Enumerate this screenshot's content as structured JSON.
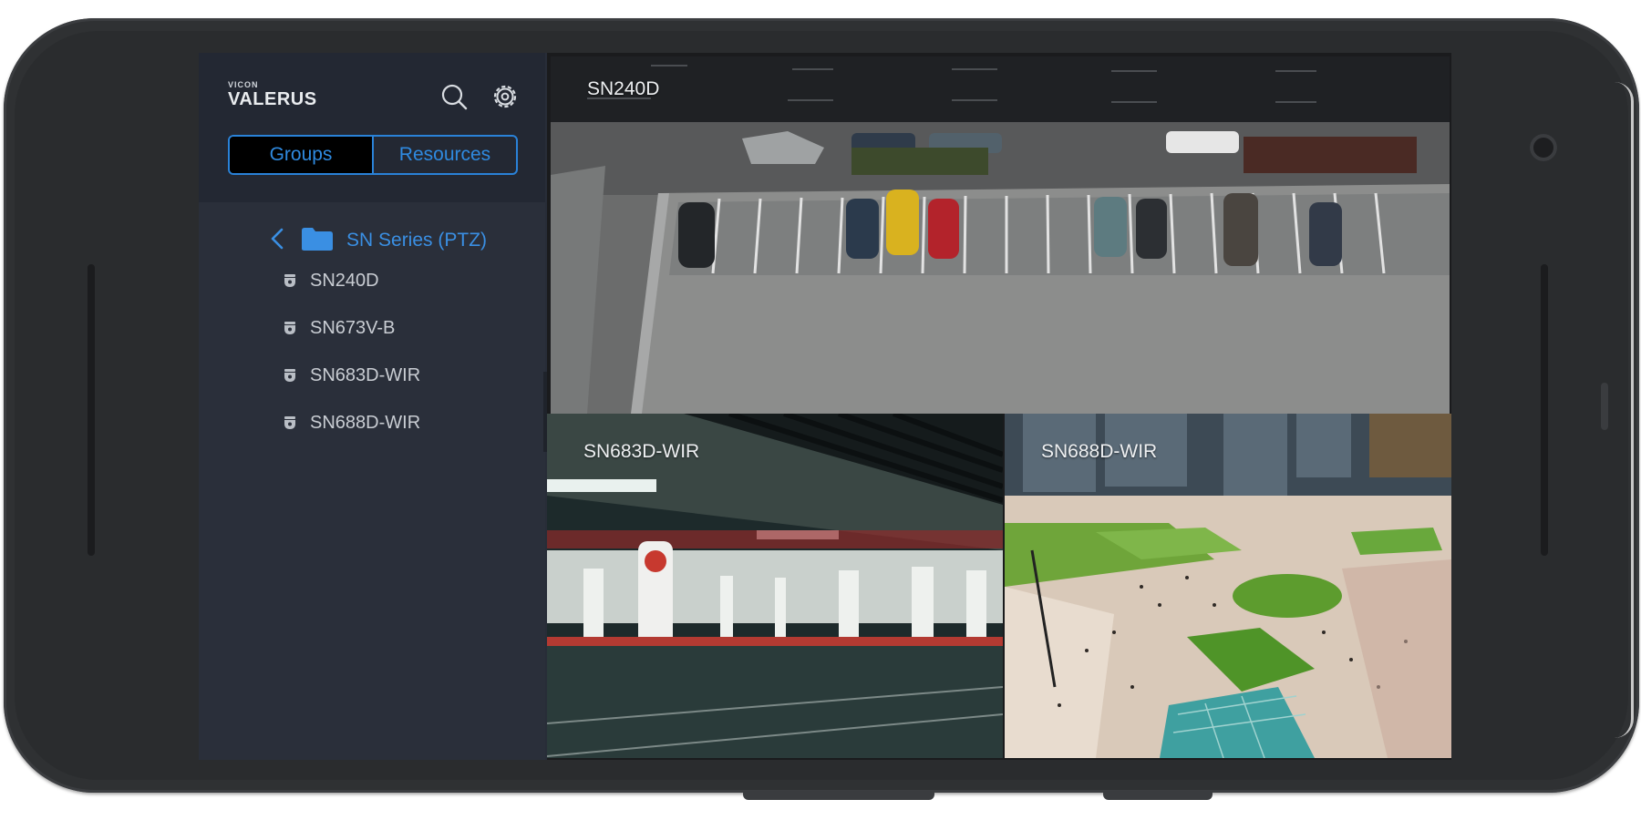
{
  "app": {
    "brand": "VICON",
    "product": "VALERUS"
  },
  "sidebar": {
    "tabs": [
      {
        "label": "Groups",
        "active": true
      },
      {
        "label": "Resources",
        "active": false
      }
    ],
    "folder": {
      "label": "SN Series (PTZ)"
    },
    "cameras": [
      {
        "label": "SN240D"
      },
      {
        "label": "SN673V-B"
      },
      {
        "label": "SN683D-WIR"
      },
      {
        "label": "SN688D-WIR"
      }
    ]
  },
  "video": {
    "tiles": [
      {
        "label": "SN240D"
      },
      {
        "label": "SN683D-WIR"
      },
      {
        "label": "SN688D-WIR"
      }
    ]
  },
  "icons": {
    "search": "search-icon",
    "settings": "gear-icon",
    "back": "chevron-left-icon",
    "folder": "folder-icon",
    "camera": "dome-camera-icon",
    "panel_handle": "drag-handle-icon"
  },
  "colors": {
    "accent": "#2f8ae0",
    "sidebar_bg": "#2a2f3a",
    "sidebar_header_bg": "#232833",
    "tab_active_bg": "#000000",
    "phone_body": "#2f3133"
  }
}
